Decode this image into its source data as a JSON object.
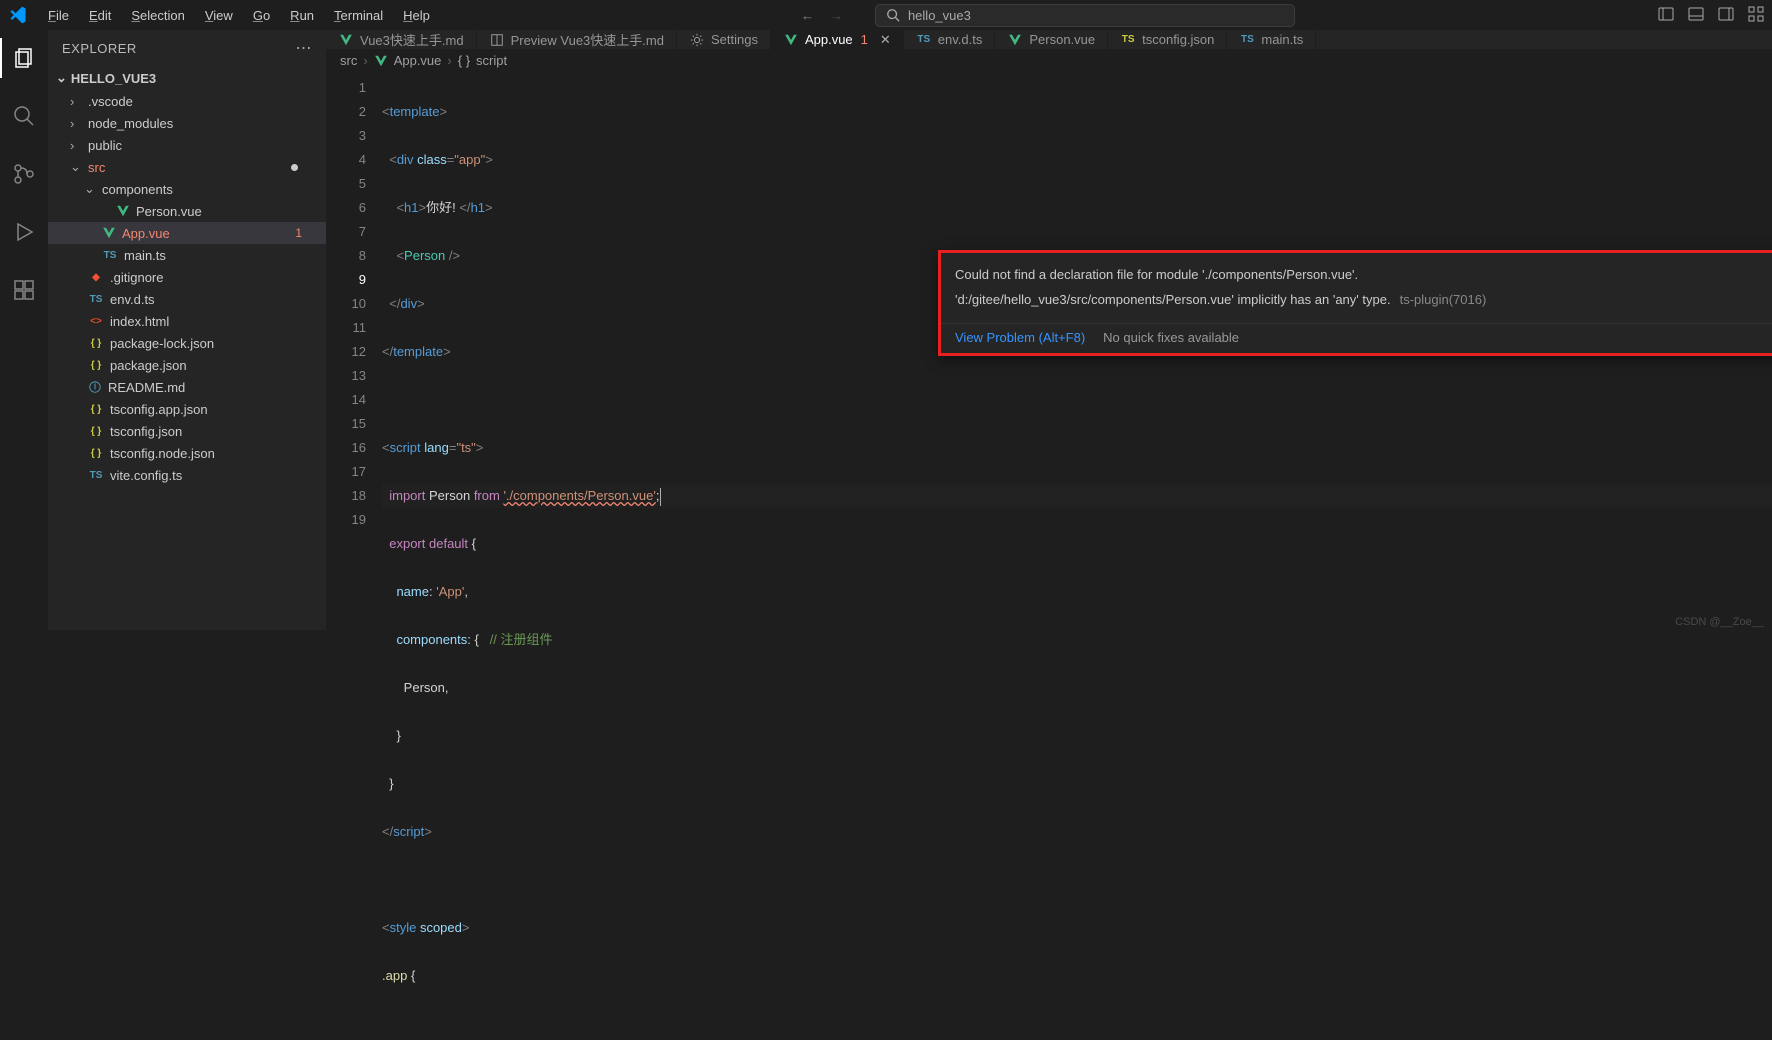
{
  "menubar": {
    "items": [
      "File",
      "Edit",
      "Selection",
      "View",
      "Go",
      "Run",
      "Terminal",
      "Help"
    ],
    "search_text": "hello_vue3"
  },
  "sidebar": {
    "title": "EXPLORER",
    "section": "HELLO_VUE3",
    "tree": [
      {
        "name": ".vscode",
        "kind": "folder",
        "depth": 1,
        "expanded": false
      },
      {
        "name": "node_modules",
        "kind": "folder",
        "depth": 1,
        "expanded": false
      },
      {
        "name": "public",
        "kind": "folder",
        "depth": 1,
        "expanded": false
      },
      {
        "name": "src",
        "kind": "folder",
        "depth": 1,
        "expanded": true,
        "error": true,
        "modified": true
      },
      {
        "name": "components",
        "kind": "folder",
        "depth": 2,
        "expanded": true
      },
      {
        "name": "Person.vue",
        "kind": "vue",
        "depth": 3
      },
      {
        "name": "App.vue",
        "kind": "vue",
        "depth": 2,
        "error": true,
        "selected": true,
        "badge": "1"
      },
      {
        "name": "main.ts",
        "kind": "ts",
        "depth": 2
      },
      {
        "name": ".gitignore",
        "kind": "git",
        "depth": 1
      },
      {
        "name": "env.d.ts",
        "kind": "ts",
        "depth": 1
      },
      {
        "name": "index.html",
        "kind": "html",
        "depth": 1
      },
      {
        "name": "package-lock.json",
        "kind": "json",
        "depth": 1
      },
      {
        "name": "package.json",
        "kind": "json",
        "depth": 1
      },
      {
        "name": "README.md",
        "kind": "md",
        "depth": 1
      },
      {
        "name": "tsconfig.app.json",
        "kind": "json",
        "depth": 1
      },
      {
        "name": "tsconfig.json",
        "kind": "json",
        "depth": 1
      },
      {
        "name": "tsconfig.node.json",
        "kind": "json",
        "depth": 1
      },
      {
        "name": "vite.config.ts",
        "kind": "ts",
        "depth": 1
      }
    ]
  },
  "tabs": [
    {
      "label": "Vue3快速上手.md",
      "icon": "vue"
    },
    {
      "label": "Preview Vue3快速上手.md",
      "icon": "preview"
    },
    {
      "label": "Settings",
      "icon": "gear"
    },
    {
      "label": "App.vue",
      "icon": "vue",
      "active": true,
      "error": "1",
      "close": true
    },
    {
      "label": "env.d.ts",
      "icon": "ts"
    },
    {
      "label": "Person.vue",
      "icon": "vue"
    },
    {
      "label": "tsconfig.json",
      "icon": "json"
    },
    {
      "label": "main.ts",
      "icon": "ts"
    }
  ],
  "breadcrumbs": [
    "src",
    "App.vue",
    "script"
  ],
  "line_nums": [
    "1",
    "2",
    "3",
    "4",
    "5",
    "6",
    "7",
    "8",
    "9",
    "10",
    "11",
    "12",
    "13",
    "14",
    "15",
    "16",
    "17",
    "18",
    "19"
  ],
  "code_text": {
    "l3_text": "你好! ",
    "l11_name": "name",
    "l11_val": "'App'",
    "l12_name": "components",
    "l12_cmt": "// 注册组件",
    "l13_txt": "Person,"
  },
  "import_str": "'./components/Person.vue'",
  "hover": {
    "msg1": "Could not find a declaration file for module './components/Person.vue'.",
    "msg2": "'d:/gitee/hello_vue3/src/components/Person.vue' implicitly has an 'any' type.",
    "src": "ts-plugin(7016)",
    "action_link": "View Problem (Alt+F8)",
    "action_txt": "No quick fixes available"
  },
  "watermark": "CSDN @__Zoe__"
}
